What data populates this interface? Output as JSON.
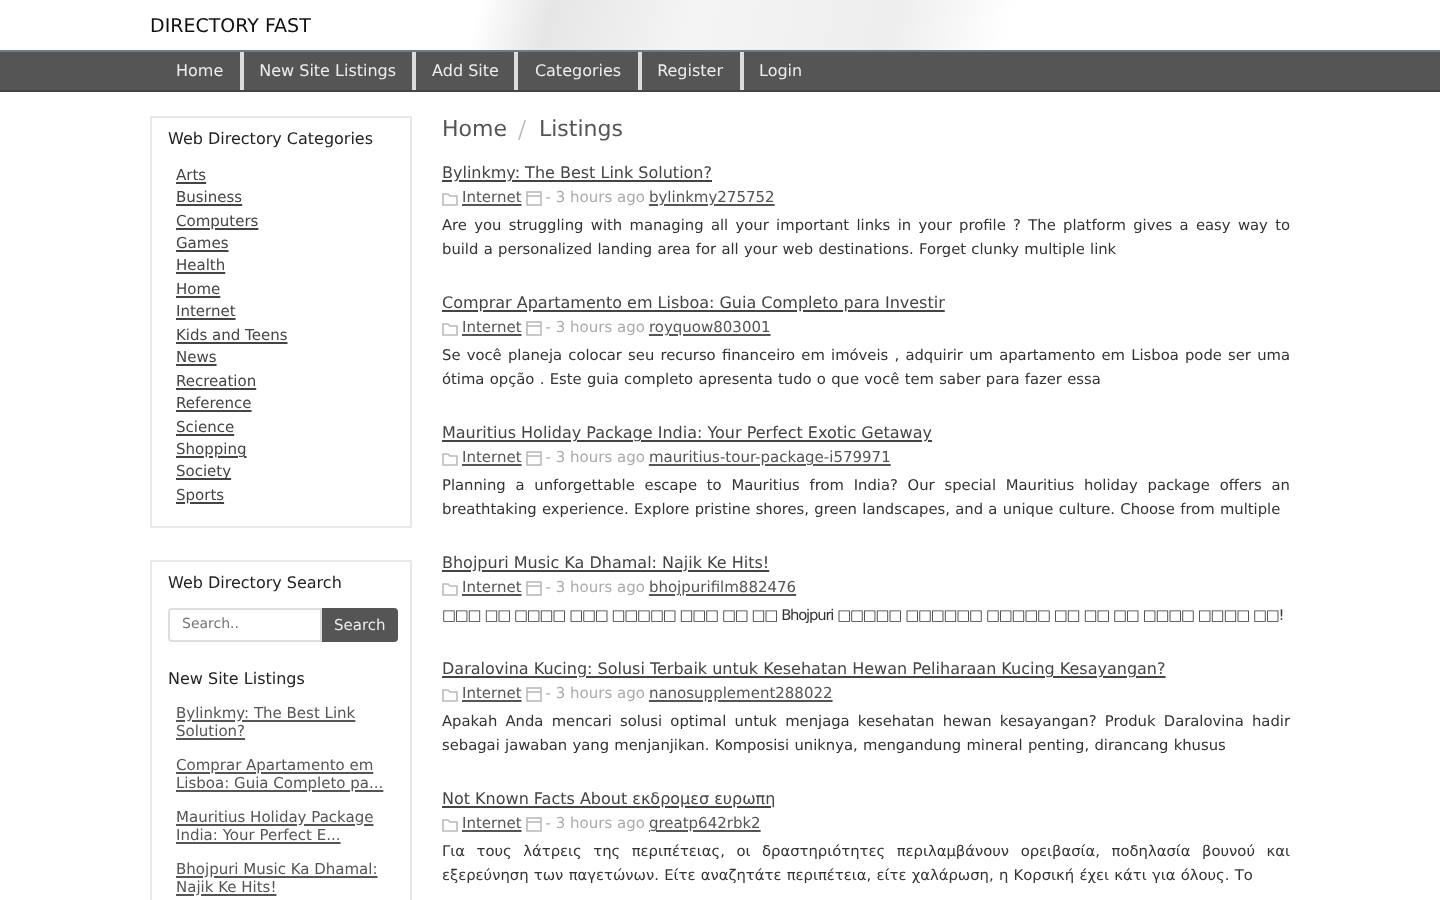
{
  "brand": "DIRECTORY FAST",
  "nav": [
    {
      "label": "Home"
    },
    {
      "label": "New Site Listings"
    },
    {
      "label": "Add Site"
    },
    {
      "label": "Categories"
    },
    {
      "label": "Register"
    },
    {
      "label": "Login"
    }
  ],
  "sidebar": {
    "categories_title": "Web Directory Categories",
    "categories": [
      "Arts",
      "Business",
      "Computers",
      "Games",
      "Health",
      "Home",
      "Internet",
      "Kids and Teens",
      "News",
      "Recreation",
      "Reference",
      "Science",
      "Shopping",
      "Society",
      "Sports"
    ],
    "search_title": "Web Directory Search",
    "search": {
      "placeholder": "Search..",
      "button": "Search"
    },
    "new_listings_title": "New Site Listings",
    "new_listings": [
      "Bylinkmy: The Best Link Solution?",
      "Comprar Apartamento em Lisboa: Guia Completo pa...",
      "Mauritius Holiday Package India: Your Perfect E...",
      "Bhojpuri Music Ka Dhamal: Najik Ke Hits!"
    ]
  },
  "breadcrumb": [
    "Home",
    "Listings"
  ],
  "listings": [
    {
      "title": "Bylinkmy: The Best Link Solution?",
      "category": "Internet",
      "time": "- 3 hours ago",
      "user": "bylinkmy275752",
      "description": "Are you struggling with managing all your important links in your profile ? The platform gives a easy way to build a personalized landing area for all your web destinations. Forget clunky multiple link"
    },
    {
      "title": "Comprar Apartamento em Lisboa: Guia Completo para Investir",
      "category": "Internet",
      "time": "- 3 hours ago",
      "user": "royquow803001",
      "description": "Se você planeja colocar seu recurso financeiro em imóveis , adquirir um apartamento em Lisboa pode ser uma ótima opção . Este guia completo apresenta tudo o que você tem saber para fazer essa"
    },
    {
      "title": "Mauritius Holiday Package India: Your Perfect Exotic Getaway",
      "category": "Internet",
      "time": "- 3 hours ago",
      "user": "mauritius-tour-package-i579971",
      "description": "Planning a unforgettable escape to Mauritius from India? Our special Mauritius holiday package offers an breathtaking experience. Explore pristine shores, green landscapes, and a unique culture. Choose from multiple"
    },
    {
      "title": "Bhojpuri Music Ka Dhamal: Najik Ke Hits!",
      "category": "Internet",
      "time": "- 3 hours ago",
      "user": "bhojpurifilm882476",
      "description": "□□□ □□ □□□□ □□□ □□□□□ □□□ □□ □□ Bhojpuri □□□□□ □□□□□□ □□□□□ □□ □□ □□ □□□□ □□□□ □□!"
    },
    {
      "title": "Daralovina Kucing: Solusi Terbaik untuk Kesehatan Hewan Peliharaan Kucing Kesayangan?",
      "category": "Internet",
      "time": "- 3 hours ago",
      "user": "nanosupplement288022",
      "description": "Apakah Anda mencari solusi optimal untuk menjaga kesehatan hewan kesayangan? Produk Daralovina hadir sebagai jawaban yang menjanjikan. Komposisi uniknya, mengandung mineral penting, dirancang khusus"
    },
    {
      "title": "Not Known Facts About εκδρομεσ ευρωπη",
      "category": "Internet",
      "time": "- 3 hours ago",
      "user": "greatp642rbk2",
      "description": "Για τους λάτρεις της περιπέτειας, οι δραστηριότητες περιλαμβάνουν ορειβασία, ποδηλασία βουνού και εξερεύνηση των παγετώνων. Είτε αναζητάτε περιπέτεια, είτε χαλάρωση, η Κορσική έχει κάτι για όλους. Το"
    }
  ]
}
